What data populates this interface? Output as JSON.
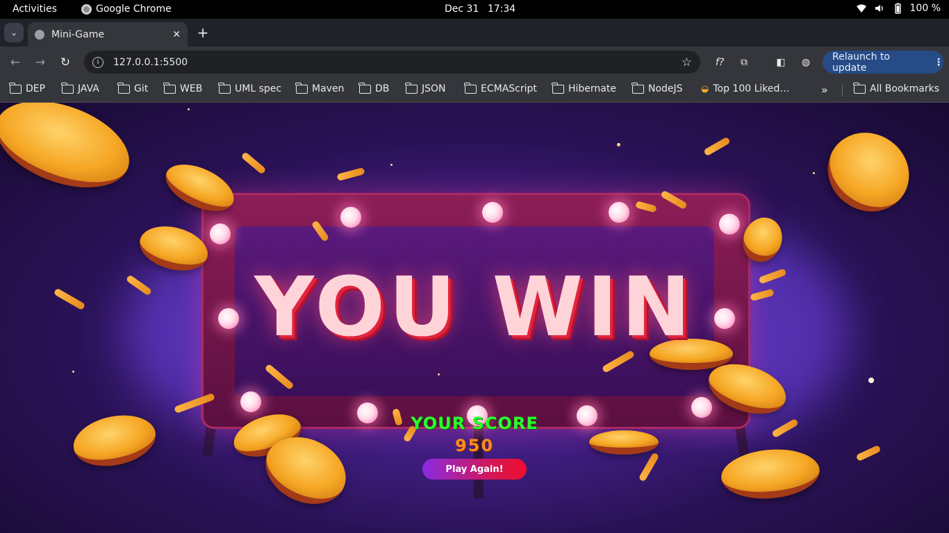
{
  "os_bar": {
    "activities": "Activities",
    "app_name": "Google Chrome",
    "date": "Dec 31",
    "time": "17:34",
    "battery": "100 %"
  },
  "browser": {
    "tab_title": "Mini-Game",
    "url": "127.0.0.1:5500",
    "relaunch_label": "Relaunch to update",
    "bookmarks": [
      "DEP",
      "JAVA",
      "Git",
      "WEB",
      "UML spec",
      "Maven",
      "DB",
      "JSON",
      "ECMAScript",
      "Hibernate",
      "NodeJS",
      "Top 100 Liked…"
    ],
    "all_bookmarks": "All Bookmarks"
  },
  "game": {
    "headline": "YOU WIN",
    "score_label": "YOUR SCORE",
    "score_value": "950",
    "play_again_label": "Play Again!"
  },
  "colors": {
    "score_label": "#2dfc2d",
    "score_value": "#ff8c1a",
    "button_start": "#8a2be2",
    "button_end": "#ee0e2e"
  }
}
